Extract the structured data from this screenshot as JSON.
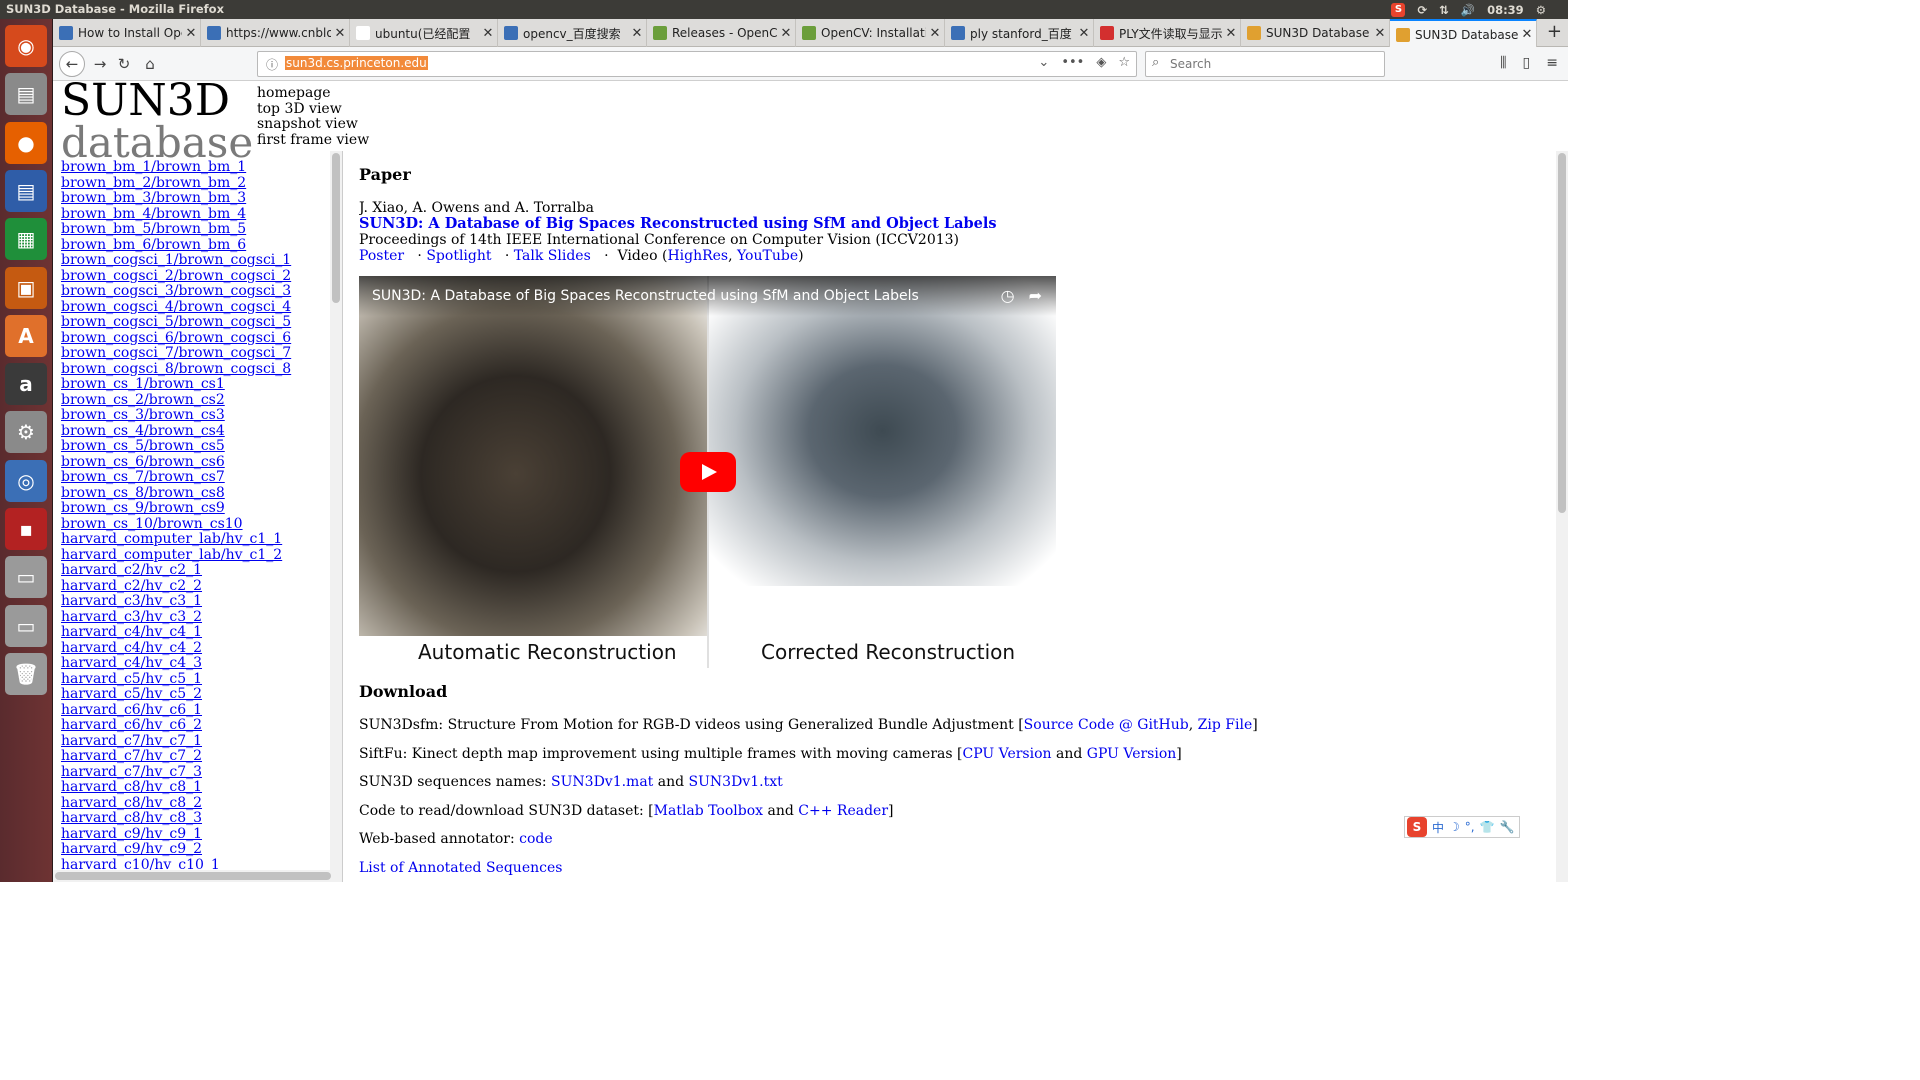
{
  "system": {
    "window_title": "SUN3D Database - Mozilla Firefox",
    "clock": "08:39"
  },
  "launcher": {
    "items": [
      {
        "name": "ubuntu-dash",
        "color": "#d64a1c",
        "glyph": "◉"
      },
      {
        "name": "files",
        "color": "#8a8a8a",
        "glyph": "▤"
      },
      {
        "name": "firefox",
        "color": "#e66000",
        "glyph": "●"
      },
      {
        "name": "writer",
        "color": "#2f5da8",
        "glyph": "▤"
      },
      {
        "name": "calc",
        "color": "#1f8f3a",
        "glyph": "▦"
      },
      {
        "name": "impress",
        "color": "#c55a11",
        "glyph": "▣"
      },
      {
        "name": "software-center",
        "color": "#e0702b",
        "glyph": "A"
      },
      {
        "name": "amazon",
        "color": "#3a3a3a",
        "glyph": "a"
      },
      {
        "name": "settings",
        "color": "#8a8a8a",
        "glyph": "⚙"
      },
      {
        "name": "shutter",
        "color": "#3b6fb6",
        "glyph": "◎"
      },
      {
        "name": "workspace",
        "color": "#b32222",
        "glyph": "▪"
      },
      {
        "name": "drive-1",
        "color": "#9a9a9a",
        "glyph": "▭"
      },
      {
        "name": "drive-2",
        "color": "#9a9a9a",
        "glyph": "▭"
      },
      {
        "name": "trash",
        "color": "#9a9a9a",
        "glyph": "🗑"
      }
    ]
  },
  "tabs": [
    {
      "label": "How to Install Ope",
      "favicon": "#3b6fb6",
      "active": false
    },
    {
      "label": "https://www.cnblo",
      "favicon": "#3b6fb6",
      "active": false
    },
    {
      "label": "ubuntu(已经配置",
      "favicon": "#ffffff",
      "active": false
    },
    {
      "label": "opencv_百度搜索",
      "favicon": "#3b6fb6",
      "active": false
    },
    {
      "label": "Releases - OpenCV",
      "favicon": "#6b9e3b",
      "active": false
    },
    {
      "label": "OpenCV: Installati",
      "favicon": "#6b9e3b",
      "active": false
    },
    {
      "label": "ply stanford_百度",
      "favicon": "#3b6fb6",
      "active": false
    },
    {
      "label": "PLY文件读取与显示",
      "favicon": "#d32f2f",
      "active": false
    },
    {
      "label": "SUN3D Database",
      "favicon": "#e0a030",
      "active": false
    },
    {
      "label": "SUN3D Database",
      "favicon": "#e0a030",
      "active": true
    }
  ],
  "navbar": {
    "url": "sun3d.cs.princeton.edu",
    "search_placeholder": "Search"
  },
  "site": {
    "logo_line1": "SUN3D",
    "logo_line2": "database",
    "nav": [
      "homepage",
      "top 3D view",
      "snapshot view",
      "first frame view"
    ]
  },
  "sidebar": {
    "sequences": [
      "brown_bm_1/brown_bm_1",
      "brown_bm_2/brown_bm_2",
      "brown_bm_3/brown_bm_3",
      "brown_bm_4/brown_bm_4",
      "brown_bm_5/brown_bm_5",
      "brown_bm_6/brown_bm_6",
      "brown_cogsci_1/brown_cogsci_1",
      "brown_cogsci_2/brown_cogsci_2",
      "brown_cogsci_3/brown_cogsci_3",
      "brown_cogsci_4/brown_cogsci_4",
      "brown_cogsci_5/brown_cogsci_5",
      "brown_cogsci_6/brown_cogsci_6",
      "brown_cogsci_7/brown_cogsci_7",
      "brown_cogsci_8/brown_cogsci_8",
      "brown_cs_1/brown_cs1",
      "brown_cs_2/brown_cs2",
      "brown_cs_3/brown_cs3",
      "brown_cs_4/brown_cs4",
      "brown_cs_5/brown_cs5",
      "brown_cs_6/brown_cs6",
      "brown_cs_7/brown_cs7",
      "brown_cs_8/brown_cs8",
      "brown_cs_9/brown_cs9",
      "brown_cs_10/brown_cs10",
      "harvard_computer_lab/hv_c1_1",
      "harvard_computer_lab/hv_c1_2",
      "harvard_c2/hv_c2_1",
      "harvard_c2/hv_c2_2",
      "harvard_c3/hv_c3_1",
      "harvard_c3/hv_c3_2",
      "harvard_c4/hv_c4_1",
      "harvard_c4/hv_c4_2",
      "harvard_c4/hv_c4_3",
      "harvard_c5/hv_c5_1",
      "harvard_c5/hv_c5_2",
      "harvard_c6/hv_c6_1",
      "harvard_c6/hv_c6_2",
      "harvard_c7/hv_c7_1",
      "harvard_c7/hv_c7_2",
      "harvard_c7/hv_c7_3",
      "harvard_c8/hv_c8_1",
      "harvard_c8/hv_c8_2",
      "harvard_c8/hv_c8_3",
      "harvard_c9/hv_c9_1",
      "harvard_c9/hv_c9_2",
      "harvard_c10/hv_c10_1"
    ]
  },
  "paper": {
    "heading": "Paper",
    "authors": "J. Xiao, A. Owens and A. Torralba",
    "title": "SUN3D: A Database of Big Spaces Reconstructed using SfM and Object Labels",
    "proceedings": "Proceedings of 14th IEEE International Conference on Computer Vision (ICCV2013)",
    "links": {
      "poster": "Poster",
      "spotlight": "Spotlight",
      "talk_slides": "Talk Slides",
      "video_prefix": "Video (",
      "highres": "HighRes",
      "youtube": "YouTube",
      "video_suffix": ")"
    },
    "video": {
      "title": "SUN3D: A Database of Big Spaces Reconstructed using SfM and Object Labels",
      "caption_left": "Automatic Reconstruction",
      "caption_right": "Corrected Reconstruction"
    }
  },
  "download": {
    "heading": "Download",
    "sfm_text": "SUN3Dsfm: Structure From Motion for RGB-D videos using Generalized Bundle Adjustment [",
    "sfm_link1": "Source Code @ GitHub",
    "sfm_link2": "Zip File",
    "siftfu_text": "SiftFu: Kinect depth map improvement using multiple frames with moving cameras [",
    "siftfu_link1": "CPU Version",
    "siftfu_link2": "GPU Version",
    "names_text": "SUN3D sequences names: ",
    "names_link1": "SUN3Dv1.mat",
    "names_link2": "SUN3Dv1.txt",
    "code_text": "Code to read/download SUN3D dataset: [",
    "code_link1": "Matlab Toolbox",
    "code_link2": "C++ Reader",
    "annot_text": "Web-based annotator: ",
    "annot_link": "code",
    "list_link": "List of Annotated Sequences",
    "and": "and",
    "close_bracket": "]",
    "comma": ","
  },
  "ime": {
    "logo": "S",
    "mode": "中"
  }
}
